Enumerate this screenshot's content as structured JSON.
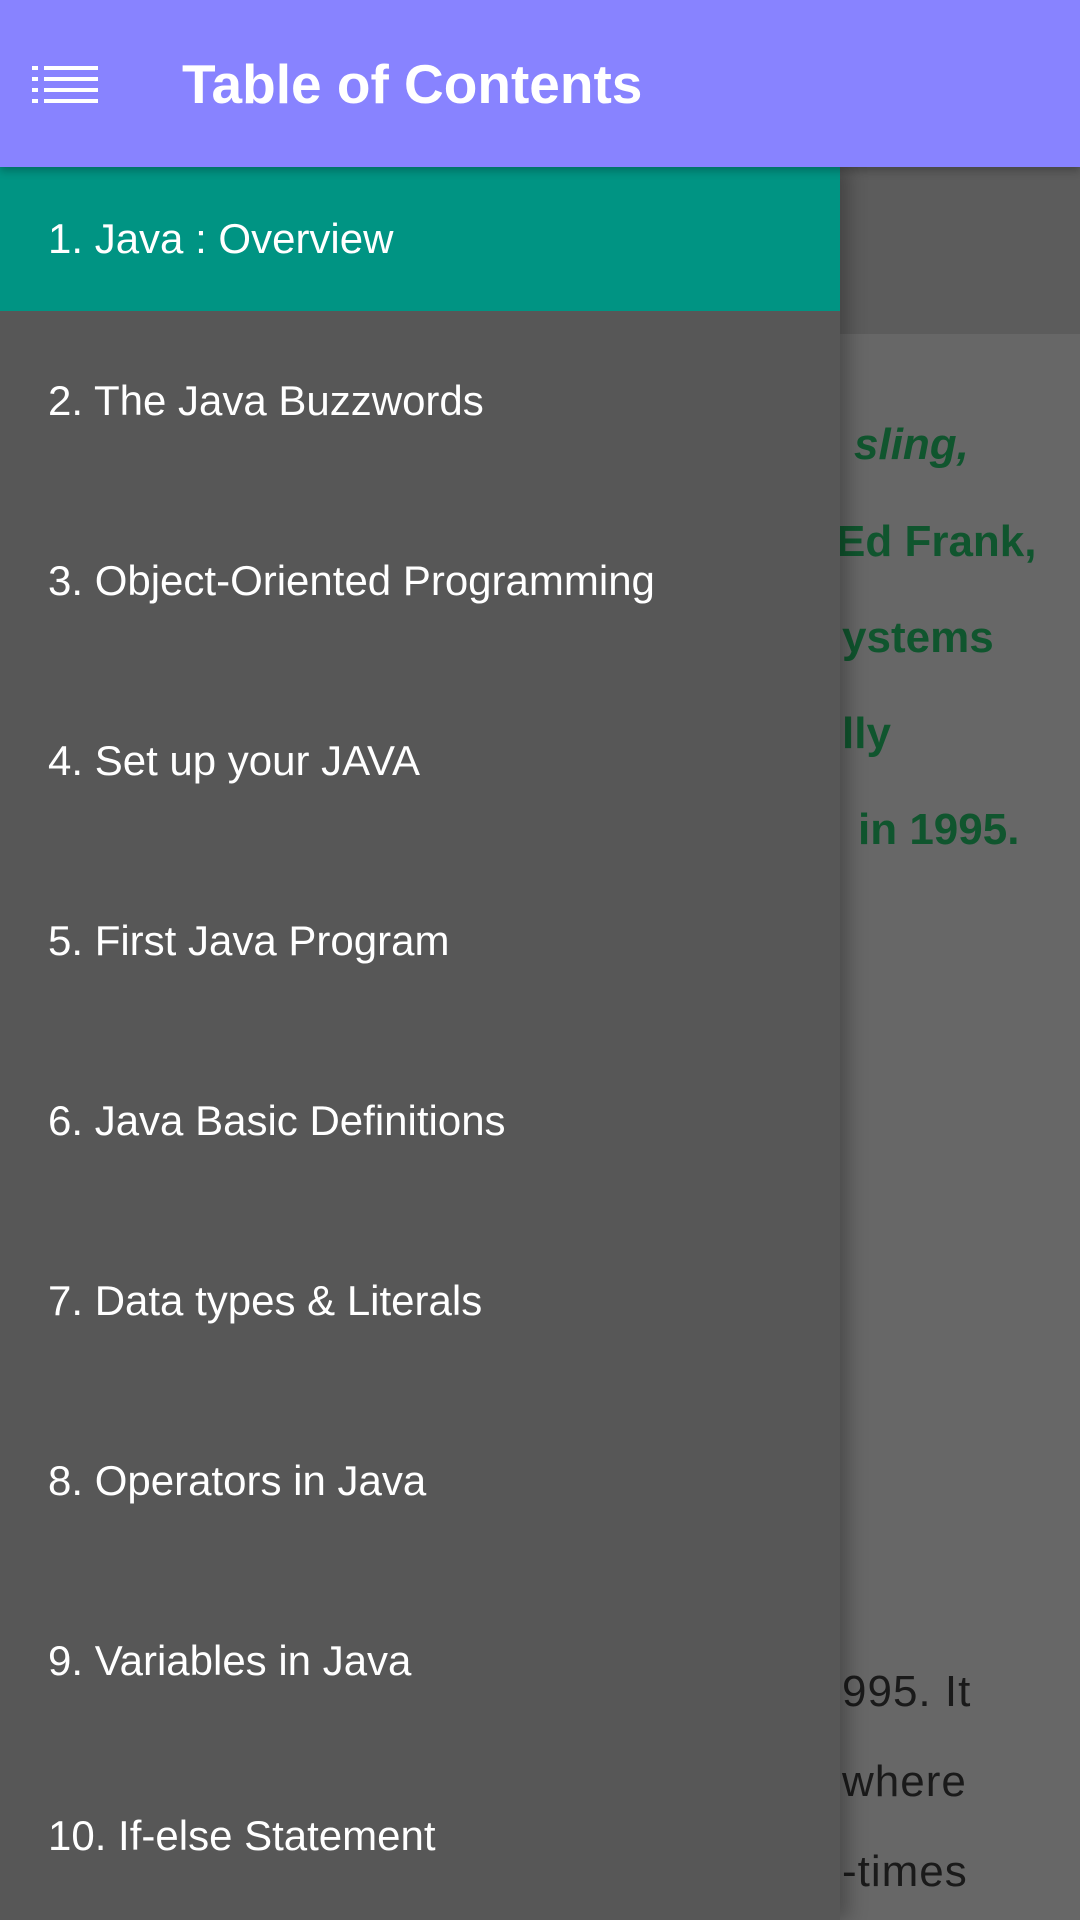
{
  "toolbar": {
    "title": "Table of Contents",
    "menu_icon": "menu-list-icon",
    "background_color": "#8883ff"
  },
  "drawer": {
    "active_index": 0,
    "active_color": "#009483",
    "background_color": "#575757",
    "items": [
      {
        "label": "1. Java : Overview"
      },
      {
        "label": "2. The Java Buzzwords"
      },
      {
        "label": "3. Object-Oriented Programming"
      },
      {
        "label": "4. Set up your JAVA"
      },
      {
        "label": "5. First Java Program"
      },
      {
        "label": "6. Java Basic Definitions"
      },
      {
        "label": "7. Data types & Literals"
      },
      {
        "label": "8. Operators in Java"
      },
      {
        "label": "9. Variables in Java"
      },
      {
        "label": "10. If-else Statement"
      }
    ]
  },
  "background_content": {
    "lines": [
      {
        "text": "sling,"
      },
      {
        "text": "Ed Frank,"
      },
      {
        "text": "ystems"
      },
      {
        "text": "lly"
      },
      {
        "text": "in 1995."
      },
      {
        "text": "995. It"
      },
      {
        "text": "where"
      },
      {
        "text": "-times"
      }
    ]
  }
}
